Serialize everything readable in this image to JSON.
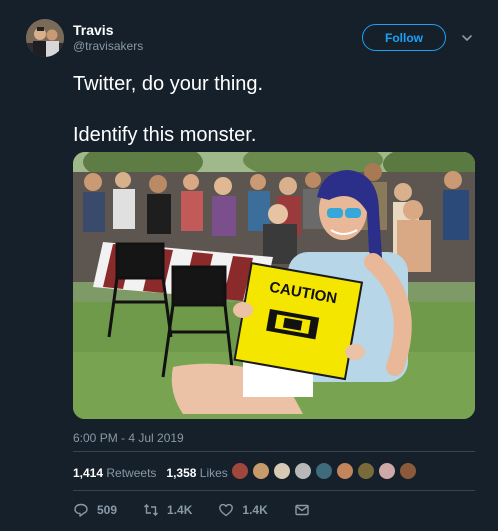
{
  "user": {
    "name": "Travis",
    "handle": "@travisakers"
  },
  "follow_label": "Follow",
  "tweet": {
    "line1": "Twitter, do your thing.",
    "line2": "Identify this monster."
  },
  "photo": {
    "sign_text": "CAUTION"
  },
  "timestamp": "6:00 PM - 4 Jul 2019",
  "stats": {
    "retweets_count": "1,414",
    "retweets_label": "Retweets",
    "likes_count": "1,358",
    "likes_label": "Likes"
  },
  "likers_colors": [
    "#a0473d",
    "#c79a6a",
    "#d8c9b4",
    "#b8b8b8",
    "#3f6b7a",
    "#c2855c",
    "#7a6a3a",
    "#cfa8a8",
    "#8a5a3a"
  ],
  "actions": {
    "replies": "509",
    "retweets": "1.4K",
    "likes": "1.4K"
  },
  "colors": {
    "background": "#15202b",
    "accent": "#1da1f2",
    "secondary_text": "#8899a6",
    "divider": "#38444d"
  }
}
